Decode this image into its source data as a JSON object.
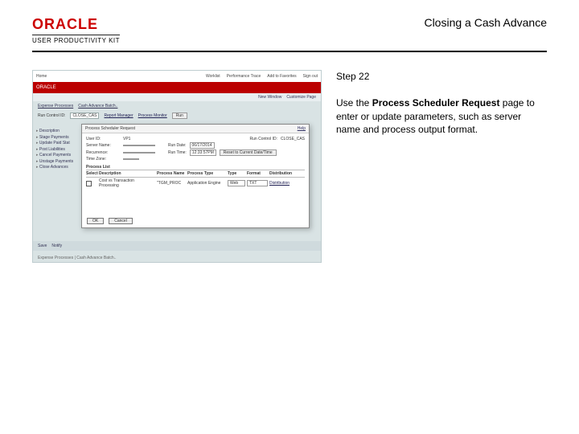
{
  "header": {
    "brand": "ORACLE",
    "upk": "USER PRODUCTIVITY KIT",
    "title": "Closing a Cash Advance"
  },
  "step": {
    "label": "Step 22",
    "instruction_prefix": "Use the ",
    "instruction_bold": "Process Scheduler Request",
    "instruction_suffix": " page to enter or update parameters, such as server name and process output format."
  },
  "app": {
    "top_links": [
      "Home",
      "Worklist",
      "Performance Trace",
      "Add to Favorites",
      "Sign out"
    ],
    "brand": "ORACLE",
    "subnav": [
      "New Window",
      "Customize Page"
    ],
    "crumbs": [
      "Expense Processes",
      "Cash Advance Batch.."
    ],
    "run": {
      "runctl_label": "Run Control ID:",
      "runctl_value": "CLOSE_CAS",
      "rpt_label": "Report Manager",
      "pm_label": "Process Monitor",
      "run_btn": "Run"
    },
    "side_items": [
      "Description",
      "Stage Payments",
      "Update Paid Stat",
      "Post Liabilities",
      "Cancel Payments",
      "Unstage Payments",
      "Close Advances"
    ],
    "modal": {
      "title": "Process Scheduler Request",
      "help": "Help",
      "user_lbl": "User ID:",
      "user_val": "VP1",
      "runctl_lbl": "Run Control ID:",
      "runctl_val": "CLOSE_CAS",
      "server_lbl": "Server Name:",
      "server_val": "",
      "rundate_lbl": "Run Date:",
      "rundate_val": "06/17/2014",
      "recur_lbl": "Recurrence:",
      "recur_val": "",
      "runtime_lbl": "Run Time:",
      "runtime_val": "12:33:57PM",
      "reset_btn": "Reset to Current Date/Time",
      "tz_lbl": "Time Zone:",
      "tz_val": "",
      "list_lbl": "Process List",
      "headers": [
        "Select",
        "Description",
        "Process Name",
        "Process Type",
        "Type",
        "Format",
        "Distribution"
      ],
      "row": {
        "desc": "Cost vs Transaction Processing",
        "pname": "\"TGM_PROC",
        "ptype": "Application Engine",
        "type": "Web",
        "format": "TXT",
        "dist": "Distribution"
      },
      "ok": "OK",
      "cancel": "Cancel"
    },
    "footer_items": [
      "Save",
      "Notify"
    ],
    "footer_note": "Expense Processes | Cash Advance Batch.."
  }
}
